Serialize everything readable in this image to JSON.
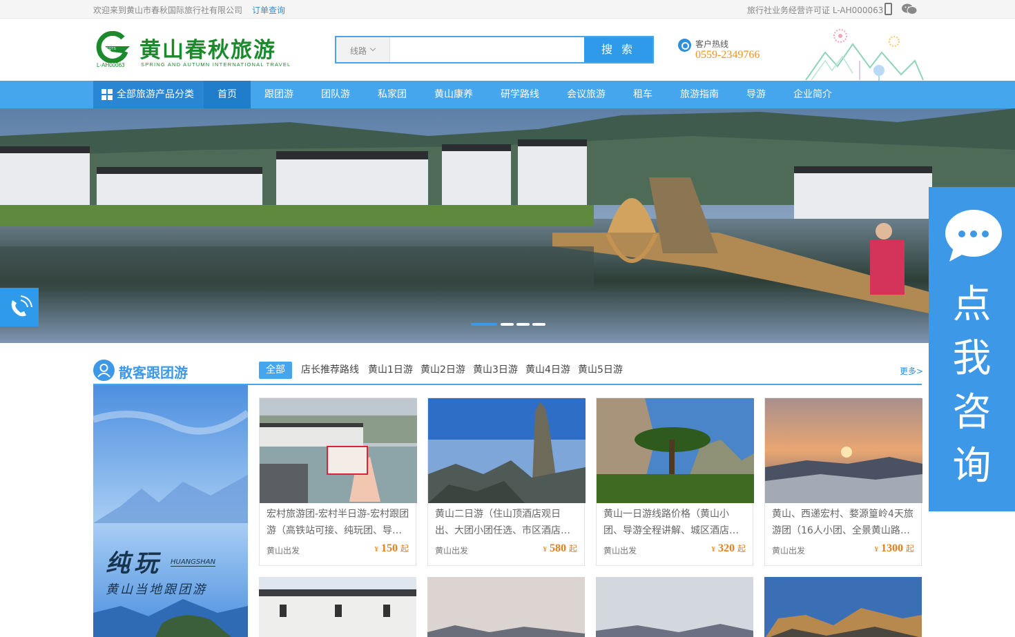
{
  "topbar": {
    "welcome": "欢迎来到黄山市春秋国际旅行社有限公司",
    "order_link": "订单查询",
    "license": "旅行社业务经营许可证 L-AH000063"
  },
  "logo": {
    "cn": "黄山春秋旅游",
    "en": "SPRING AND AUTUMN INTERNATIONAL TRAVEL",
    "license_code": "L-AH00063",
    "badge": "CQTS",
    "color": "#1b8a2d"
  },
  "search": {
    "category": "线路",
    "placeholder": "",
    "button": "搜 索"
  },
  "hotline": {
    "label": "客户热线",
    "number": "0559-2349766"
  },
  "nav": {
    "all_label": "全部旅游产品分类",
    "items": [
      "首页",
      "跟团游",
      "团队游",
      "私家团",
      "黄山康养",
      "研学路线",
      "会议旅游",
      "租车",
      "旅游指南",
      "导游",
      "企业简介"
    ],
    "active_index": 0
  },
  "banner": {
    "slide_count": 4,
    "active_slide": 0
  },
  "consult": {
    "chars": [
      "点",
      "我",
      "咨",
      "询"
    ]
  },
  "section": {
    "title": "散客跟团游",
    "tabs": [
      "全部",
      "店长推荐路线",
      "黄山1日游",
      "黄山2日游",
      "黄山3日游",
      "黄山4日游",
      "黄山5日游"
    ],
    "active_tab": 0,
    "more": "更多>",
    "side_ad": {
      "big": "纯玩",
      "small_en": "HUANGSHAN",
      "sub": "黄山当地跟团游"
    }
  },
  "products": [
    {
      "title": "宏村旅游团-宏村半日游-宏村跟团游（高铁站可接、纯玩团、导…",
      "from": "黄山出发",
      "currency": "¥",
      "price": "150",
      "suffix": "起"
    },
    {
      "title": "黄山二日游（住山顶酒店观日出、大团小团任选、市区酒店…",
      "from": "黄山出发",
      "currency": "¥",
      "price": "580",
      "suffix": "起"
    },
    {
      "title": "黄山一日游线路价格（黄山小团、导游全程讲解、城区酒店…",
      "from": "黄山出发",
      "currency": "¥",
      "price": "320",
      "suffix": "起"
    },
    {
      "title": "黄山、西递宏村、婺源篁岭4天旅游团（16人小团、全景黄山路…",
      "from": "黄山出发",
      "currency": "¥",
      "price": "1300",
      "suffix": "起"
    }
  ],
  "colors": {
    "primary": "#45a6ee",
    "nav_active": "#1e7cc8",
    "price": "#f07d16",
    "hotline_number": "#f0921f"
  }
}
